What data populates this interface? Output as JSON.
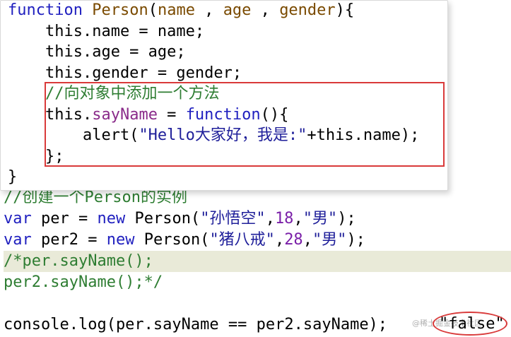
{
  "editor": {
    "lines": [
      {
        "tokens": [
          {
            "t": "//创建一个Person的实例",
            "c": "cm"
          }
        ]
      },
      {
        "tokens": [
          {
            "t": "var",
            "c": "kw"
          },
          {
            "t": " per = "
          },
          {
            "t": "new",
            "c": "kw"
          },
          {
            "t": " Person("
          },
          {
            "t": "\"孙悟空\"",
            "c": "str"
          },
          {
            "t": ","
          },
          {
            "t": "18",
            "c": "num"
          },
          {
            "t": ","
          },
          {
            "t": "\"男\"",
            "c": "str"
          },
          {
            "t": ");"
          }
        ]
      },
      {
        "tokens": [
          {
            "t": "var",
            "c": "kw"
          },
          {
            "t": " per2 = "
          },
          {
            "t": "new",
            "c": "kw"
          },
          {
            "t": " Person("
          },
          {
            "t": "\"猪八戒\"",
            "c": "str"
          },
          {
            "t": ","
          },
          {
            "t": "28",
            "c": "num"
          },
          {
            "t": ","
          },
          {
            "t": "\"男\"",
            "c": "str"
          },
          {
            "t": ");"
          }
        ]
      },
      {
        "tokens": [
          {
            "t": "/*per.sayName();",
            "c": "cm"
          }
        ]
      },
      {
        "tokens": [
          {
            "t": "per2.sayName();*/",
            "c": "cm"
          }
        ]
      },
      {
        "tokens": [
          {
            "t": ""
          }
        ]
      },
      {
        "tokens": [
          {
            "t": "console.log(per.sayName == per2.sayName);"
          }
        ]
      }
    ]
  },
  "popup": {
    "lines": [
      {
        "tokens": [
          {
            "t": "function",
            "c": "kw"
          },
          {
            "t": " "
          },
          {
            "t": "Person",
            "c": "fn"
          },
          {
            "t": "("
          },
          {
            "t": "name",
            "c": "fn"
          },
          {
            "t": " , "
          },
          {
            "t": "age",
            "c": "fn"
          },
          {
            "t": " , "
          },
          {
            "t": "gender",
            "c": "fn"
          },
          {
            "t": "){"
          }
        ]
      },
      {
        "tokens": [
          {
            "t": "    this.name = name;"
          }
        ]
      },
      {
        "tokens": [
          {
            "t": "    this.age = age;"
          }
        ]
      },
      {
        "tokens": [
          {
            "t": "    this.gender = gender;"
          }
        ]
      },
      {
        "tokens": [
          {
            "t": "    "
          },
          {
            "t": "//向对象中添加一个方法",
            "c": "cm"
          }
        ]
      },
      {
        "tokens": [
          {
            "t": "    this."
          },
          {
            "t": "sayName",
            "c": "prop"
          },
          {
            "t": " = "
          },
          {
            "t": "function",
            "c": "kw"
          },
          {
            "t": "(){"
          }
        ]
      },
      {
        "tokens": [
          {
            "t": "        alert("
          },
          {
            "t": "\"Hello大家好，我是:\"",
            "c": "str"
          },
          {
            "t": "+this.name);"
          }
        ]
      },
      {
        "tokens": [
          {
            "t": "    };"
          }
        ]
      },
      {
        "tokens": [
          {
            "t": "}"
          }
        ]
      }
    ]
  },
  "console_result": "\"false\"",
  "watermark": "@稀土掘金技术社区"
}
